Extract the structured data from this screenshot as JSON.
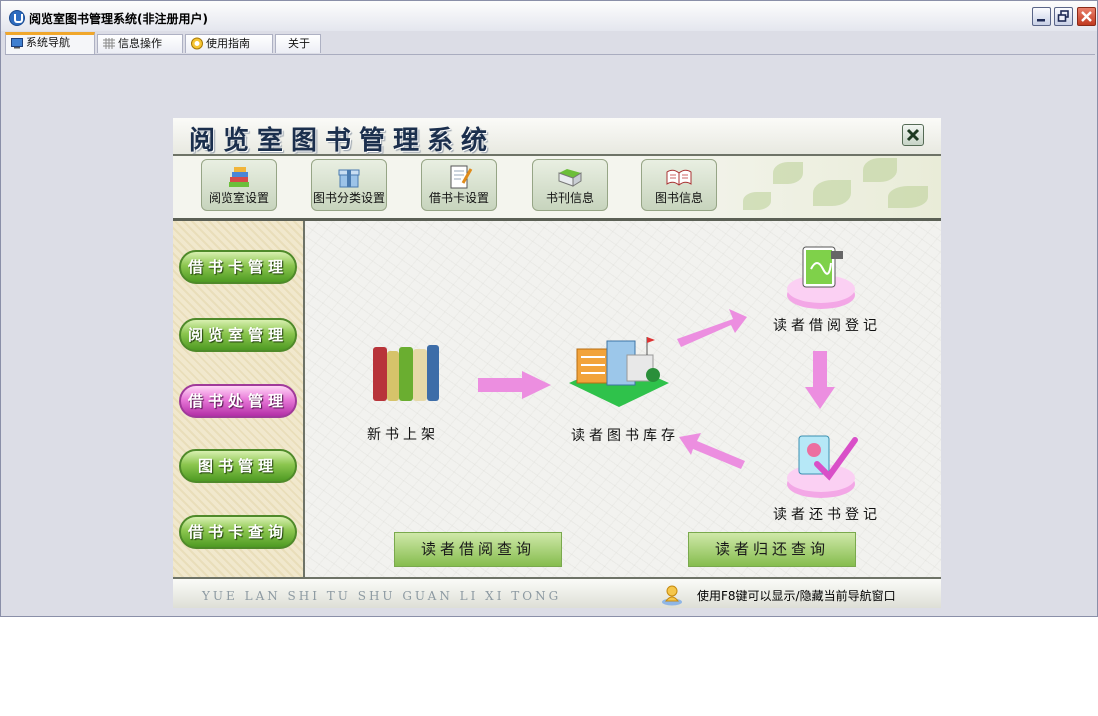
{
  "window": {
    "title": "阅览室图书管理系统(非注册用户)"
  },
  "tabs": [
    {
      "label": "系统导航",
      "icon": "monitor-icon",
      "active": true
    },
    {
      "label": "信息操作",
      "icon": "grid-icon",
      "active": false
    },
    {
      "label": "使用指南",
      "icon": "help-icon",
      "active": false
    },
    {
      "label": "关于",
      "icon": "",
      "active": false
    }
  ],
  "panel": {
    "title": "阅览室图书管理系统",
    "toolbar": [
      {
        "label": "阅览室设置",
        "icon": "books-stack-icon"
      },
      {
        "label": "图书分类设置",
        "icon": "gift-box-icon"
      },
      {
        "label": "借书卡设置",
        "icon": "notepad-pencil-icon"
      },
      {
        "label": "书刊信息",
        "icon": "folder-book-icon"
      },
      {
        "label": "图书信息",
        "icon": "open-book-icon"
      }
    ],
    "sidebar": [
      {
        "label": "借书卡管理",
        "color": "#6aae30"
      },
      {
        "label": "阅览室管理",
        "color": "#6aae30"
      },
      {
        "label": "借书处管理",
        "color": "#d957c8"
      },
      {
        "label": "图书管理",
        "color": "#6aae30"
      },
      {
        "label": "借书卡查询",
        "color": "#6aae30"
      }
    ],
    "flow": {
      "new_books": "新书上架",
      "library_stock": "读者图书库存",
      "borrow_register": "读者借阅登记",
      "return_register": "读者还书登记"
    },
    "queries": {
      "borrow_query": "读者借阅查询",
      "return_query": "读者归还查询"
    },
    "footer": {
      "left": "YUE LAN SHI TU SHU GUAN LI XI TONG",
      "right": "使用F8键可以显示/隐藏当前导航窗口"
    }
  },
  "colors": {
    "accent_green": "#6aae30",
    "accent_pink": "#d957c8",
    "arrow_pink": "#ec8ee0",
    "tab_highlight": "#f0a72c"
  }
}
